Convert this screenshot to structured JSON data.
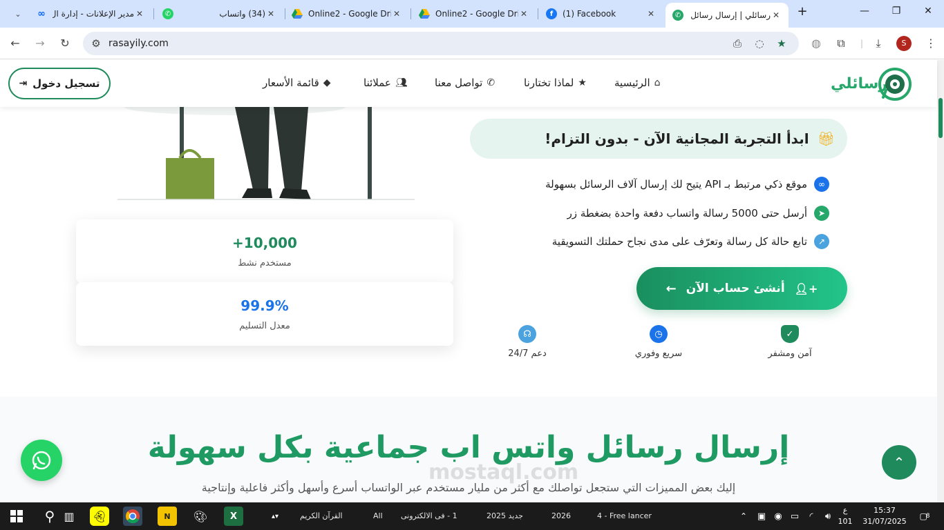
{
  "browser": {
    "tabs": [
      {
        "title": "مدير الإعلانات - إدارة ال",
        "icon": "meta-icon"
      },
      {
        "title": "(34) واتساب",
        "icon": "whatsapp-icon"
      },
      {
        "title": "Online2 - Google Driv",
        "icon": "google-drive-icon"
      },
      {
        "title": "Online2 - Google Driv",
        "icon": "google-drive-icon"
      },
      {
        "title": "(1) Facebook",
        "icon": "facebook-icon"
      },
      {
        "title": "رسائلي | إرسال رسائل و",
        "icon": "rasayily-icon",
        "active": true
      }
    ],
    "url": "rasayily.com",
    "profile_initial": "S"
  },
  "header": {
    "logo_text": "رسائلي",
    "nav": [
      {
        "label": "الرئيسية",
        "icon": "home-icon"
      },
      {
        "label": "لماذا تختارنا",
        "icon": "star-icon"
      },
      {
        "label": "تواصل معنا",
        "icon": "whatsapp-icon"
      },
      {
        "label": "عملائنا",
        "icon": "users-icon"
      },
      {
        "label": "قائمة الأسعار",
        "icon": "tag-icon"
      }
    ],
    "login_label": "تسجيل دخول"
  },
  "hero": {
    "trial_pill": "ابدأ التجربة المجانية الآن - بدون التزام!",
    "features": [
      "موقع ذكي مرتبط بـ API يتيح لك إرسال آلاف الرسائل بسهولة",
      "أرسل حتى 5000 رسالة واتساب دفعة واحدة بضغطة زر",
      "تابع حالة كل رسالة وتعرّف على مدى نجاح حملتك التسويقية"
    ],
    "cta_label": "أنشئ حساب الآن",
    "badges": [
      {
        "label": "آمن ومشفر",
        "icon": "shield-icon"
      },
      {
        "label": "سريع وفوري",
        "icon": "clock-icon"
      },
      {
        "label": "دعم 24/7",
        "icon": "headset-icon"
      }
    ],
    "stats": [
      {
        "value": "+10,000",
        "label": "مستخدم نشط",
        "color": "#1f8a5c"
      },
      {
        "value": "99.9%",
        "label": "معدل التسليم",
        "color": "#1a73e8"
      }
    ]
  },
  "section2": {
    "title": "إرسال رسائل واتس اب جماعية بكل سهولة",
    "subtitle": "إليك بعض المميزات التي ستجعل تواصلك مع أكثر من مليار مستخدم عبر الواتساب أسرع وأسهل وأكثر فاعلية وإنتاجية"
  },
  "watermark": "mostaql.com",
  "taskbar": {
    "items": [
      "القرآن الكريم",
      "All",
      "1 - فى الالكترونى",
      "جديد 2025",
      "2026",
      "4 - Free lancer"
    ],
    "lang": "ع",
    "lang_sub": "101",
    "time": "15:37",
    "date": "31/07/2025",
    "notif_count": "8"
  },
  "colors": {
    "brand": "#1f8a5c",
    "brand_light": "#25a86a",
    "accent_blue": "#1a73e8"
  }
}
